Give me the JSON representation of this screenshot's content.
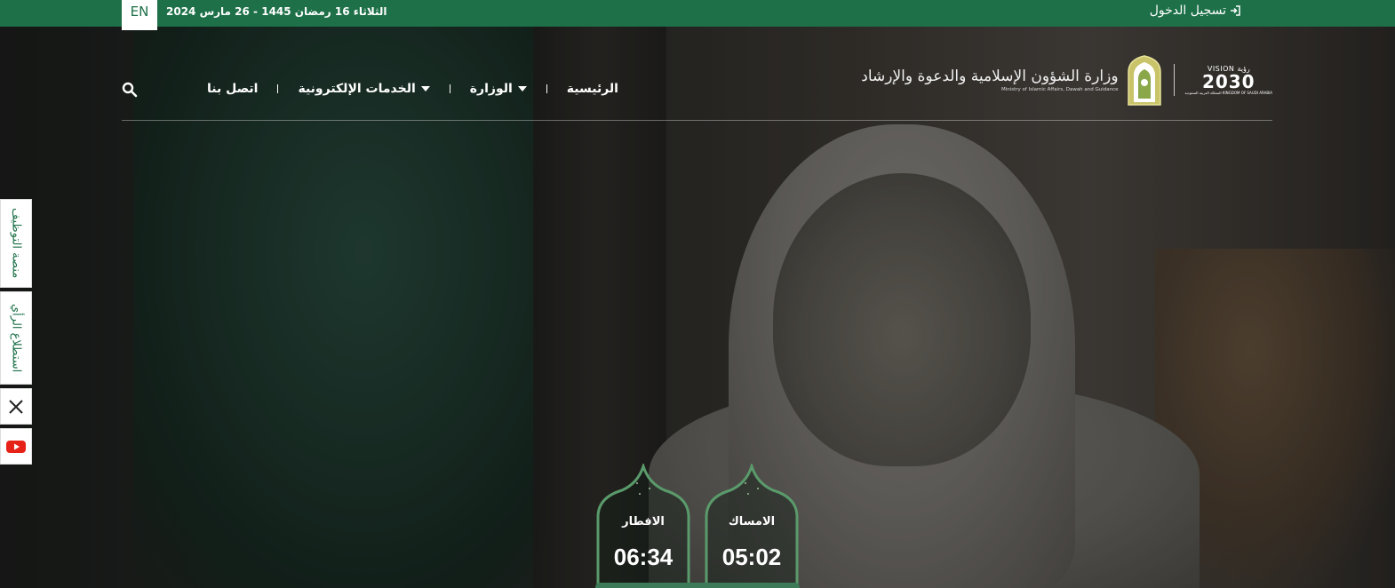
{
  "topbar": {
    "lang": "EN",
    "date": "الثلاثاء 16 رمضان 1445 - 26 مارس 2024",
    "login_label": "تسجيل الدخول"
  },
  "nav": {
    "items": [
      {
        "label": "الرئيسية",
        "has_dropdown": false
      },
      {
        "label": "الوزارة",
        "has_dropdown": true
      },
      {
        "label": "الخدمات الإلكترونية",
        "has_dropdown": true
      },
      {
        "label": "اتصل بنا",
        "has_dropdown": false
      }
    ],
    "search_icon": "search-icon"
  },
  "logo": {
    "ministry_ar": "وزارة الشؤون الإسلامية والدعوة والإرشاد",
    "ministry_en": "Ministry of Islamic Affairs, Dawah and Guidance",
    "vision_top": "VISION رؤية",
    "vision_year": "2030",
    "vision_sub": "المملكة العربية السعودية KINGDOM OF SAUDI ARABIA"
  },
  "side": {
    "jobs": "منصة التوظيف",
    "survey": "استطلاع الرأي",
    "x_icon": "x-icon",
    "youtube_icon": "youtube-icon"
  },
  "prayers": [
    {
      "name": "الامساك",
      "time": "05:02"
    },
    {
      "name": "الافطار",
      "time": "06:34"
    }
  ],
  "colors": {
    "primary_green": "#1d7048",
    "card_border": "#5a9a6b"
  }
}
